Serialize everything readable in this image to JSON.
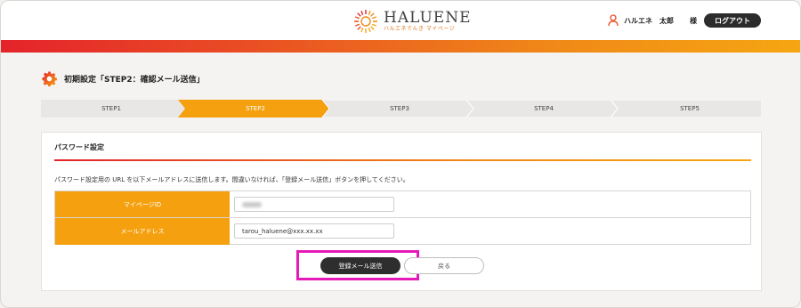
{
  "header": {
    "logo_title": "HALUENE",
    "logo_sub": "ハルエネでんき マイページ",
    "user_name": "ハルエネ　太郎",
    "honorific": "様",
    "logout_label": "ログアウト"
  },
  "page": {
    "title": "初期設定「STEP2：確認メール送信」"
  },
  "steps": [
    {
      "label": "STEP1",
      "active": false
    },
    {
      "label": "STEP2",
      "active": true
    },
    {
      "label": "STEP3",
      "active": false
    },
    {
      "label": "STEP4",
      "active": false
    },
    {
      "label": "STEP5",
      "active": false
    }
  ],
  "card": {
    "title": "パスワード設定",
    "description": "パスワード設定用の URL を以下メールアドレスに送信します。間違いなければ、「登録メール送信」ボタンを押してください。",
    "rows": [
      {
        "label": "マイページID",
        "value": ""
      },
      {
        "label": "メールアドレス",
        "value": "tarou_haluene@xxx.xx.xx"
      }
    ],
    "send_label": "登録メール送信",
    "back_label": "戻る"
  },
  "colors": {
    "accent": "#f4a00f",
    "active_step": "#f4a00f",
    "inactive_step": "#e9e7e6",
    "highlight": "#e619b9",
    "gradient_start": "#e4232b",
    "gradient_end": "#f6a612"
  },
  "icons": {
    "logo": "haluene-sun-logo",
    "user": "user-icon",
    "page_title": "gear-icon"
  }
}
